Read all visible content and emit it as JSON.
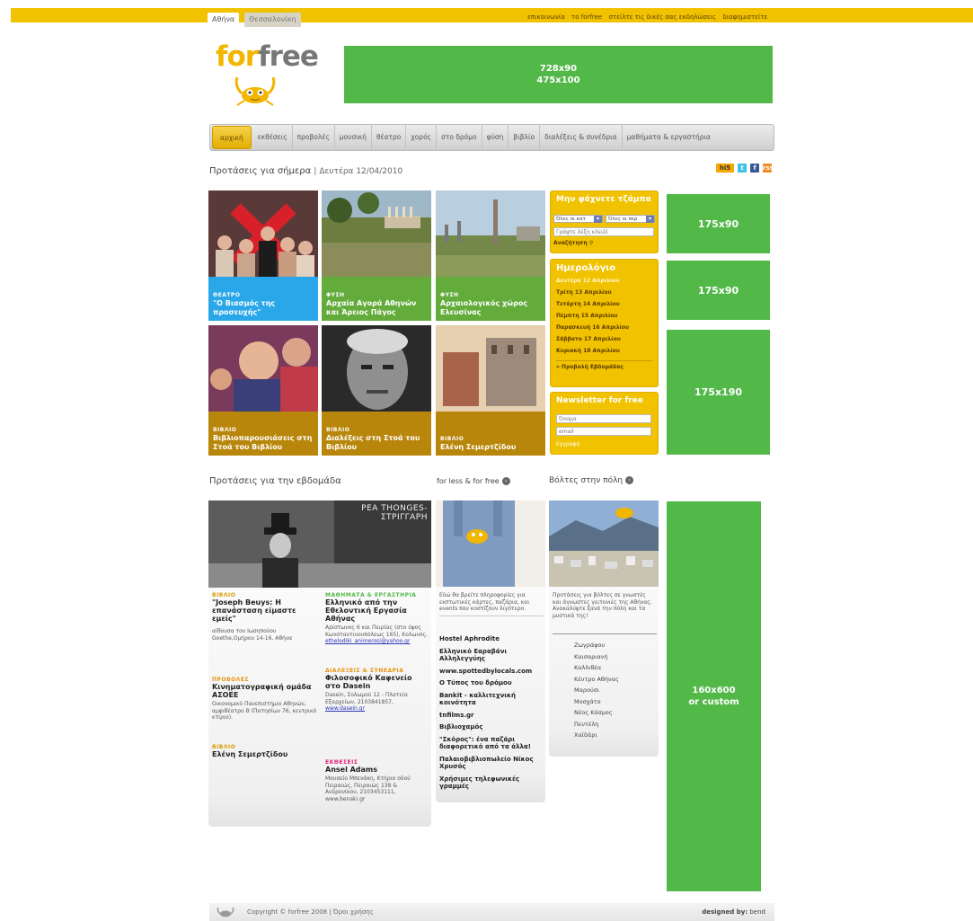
{
  "city_tabs": [
    "Αθήνα",
    "Θεσσαλονίκη"
  ],
  "top_links": [
    "επικοινωνία",
    "το forfree",
    "στείλτε τις δικές σας εκδηλώσεις",
    "διαφημιστείτε"
  ],
  "logo": {
    "part1": "for",
    "part2": "free"
  },
  "banner": {
    "line1": "728x90",
    "line2": "475x100"
  },
  "nav": [
    "αρχική",
    "εκθέσεις",
    "προβολές",
    "μουσική",
    "θέατρο",
    "χορός",
    "στο δρόμο",
    "φύση",
    "βιβλίο",
    "διαλέξεις & συνέδρια",
    "μαθήματα & εργαστήρια"
  ],
  "today": {
    "title": "Προτάσεις για σήμερα",
    "date": "| Δευτέρα 12/04/2010"
  },
  "social": [
    "hi5",
    "t",
    "f",
    "rss"
  ],
  "tiles": [
    {
      "category": "ΘΕΑΤΡΟ",
      "title": "\"Ο Βιασμός της προσευχής\""
    },
    {
      "category": "ΦΥΣΗ",
      "title": "Αρχαία Αγορά Αθηνών και Άρειος Πάγος"
    },
    {
      "category": "ΦΥΣΗ",
      "title": "Αρχαιολογικός χώρος Ελευσίνας"
    },
    {
      "category": "ΒΙΒΛΙΟ",
      "title": "Βιβλιοπαρουσιάσεις στη Στοά του Βιβλίου"
    },
    {
      "category": "ΒΙΒΛΙΟ",
      "title": "Διαλέξεις στη Στοά του Βιβλίου"
    },
    {
      "category": "ΒΙΒΛΙΟ",
      "title": "Ελένη Σεμερτζίδου"
    }
  ],
  "search_widget": {
    "title": "Μην φάχνετε τζάμπα",
    "select1": "Όλες οι κατ",
    "select2": "Όλες οι περ",
    "keyword_placeholder": "Γράψτε λέξη κλειδί",
    "search_label": "Αναζήτηση"
  },
  "calendar": {
    "title": "Ημερολόγιο",
    "days": [
      "Δευτέρα 12 Απριλίου",
      "Τρίτη 13 Απριλίου",
      "Τετάρτη 14 Απριλίου",
      "Πέμπτη 15 Απριλίου",
      "Παρασκευή 16 Απριλίου",
      "Σάββατο 17 Απριλίου",
      "Κυριακή 18 Απριλίου"
    ],
    "week_link": "» Προβολή Εβδομάδας"
  },
  "newsletter": {
    "title": "Newsletter for free",
    "name_placeholder": "Όνομα",
    "email_placeholder": "email",
    "signup_label": "Εγγραφή"
  },
  "ads": {
    "a1": "175x90",
    "a2": "175x90",
    "a3": "175x190",
    "sky1": "160x600",
    "sky2": "or custom"
  },
  "week": {
    "title": "Προτάσεις για την εβδομάδα",
    "banner_text": "ΡΕΑ ΤΗΟΝGES-ΣΤΡΙΓΓΑΡΗ",
    "left": [
      {
        "category": "ΒΙΒΛΙΟ",
        "title": "\"Joseph Beuys: Η επανάσταση είμαστε εμείς\"",
        "text": "αίθουσα του Ιωσηπούου Goethe,Ομήρου 14-16, Αθήνα"
      },
      {
        "category": "ΠΡΟΒΟΛΕΣ",
        "title": "Κινηματογραφική ομάδα ΑΣΟΕΕ",
        "text": "Οικονομικό Πανεπιστήμιο Αθηνών, αμφιθέατρο Β (Πατησίων 76, κεντρικό κτίριο)."
      },
      {
        "category": "ΒΙΒΛΙΟ",
        "title": "Ελένη Σεμερτζίδου",
        "text": ""
      }
    ],
    "right": [
      {
        "category": "ΜΑΘΗΜΑΤΑ & ΕΡΓΑΣΤΗΡΙΑ",
        "title": "Ελληνικό από την Εθελοντική Εργασία Αθήνας",
        "text": "Αρίστωνος 6 και Πειρίας (στο ύψος Κωνσταντινουπόλεως 165), Κολωνός,",
        "link": "ethelodiki_animerosi@yahoo.gr"
      },
      {
        "category": "ΔΙΑΛΕΞΕΙΣ & ΣΥΝΕΔΡΙΑ",
        "title": "Φιλοσοφικό Καφενείο στο Dasein",
        "text": "Dasein, Σολωμού 12 - Πλατεία Εξαρχείων, 2103841857,",
        "link": "www.dasein.gr"
      },
      {
        "category": "ΕΚΘΕΣΕΙΣ",
        "title": "Ansel Adams",
        "text": "Μουσείο Μπενάκη, Κτήριο οδού Πειραιώς, Πειραιώς 138 & Ανδρονίκου, 2103453111, www.benaki.gr",
        "link": ""
      }
    ]
  },
  "forless": {
    "title": "for less & for free",
    "intro": "Εδώ θα βρείτε πληροφορίες για εκπτωτικές κάρτες, παζάρια, και events που κοστίζουν λιγότερο.",
    "items": [
      "Hostel Aphrodite",
      "Ελληνικό Εαραβάνι Αλληλεγγύης",
      "www.spottedbylocals.com",
      "Ο Τύπος του δρόμου",
      "Bankit - καλλιτεχνική κοινότητα",
      "tnfilms.gr",
      "Βιβλιοχαμός",
      "\"Σκόρος\": ένα παζάρι διαφορετικό από τα άλλα!",
      "Παλαιοβιβλιοπωλείο Νίκος Χρυσός",
      "Χρήσιμες τηλεφωνικές γραμμές"
    ]
  },
  "volta": {
    "title": "Βόλτες στην πόλη",
    "intro": "Προτάσεις για βόλτες σε γνωστές και άγνωστες γειτονιές της Αθήνας. Ανακαλύψτε ξανά την πόλη και τα μυστικά της!",
    "items": [
      "Ζωγράφου",
      "Καισαριανή",
      "Καλλιθέα",
      "Κέντρο Αθήνας",
      "Μαρούσι",
      "Μοσχάτο",
      "Νέος Κόσμος",
      "Πεντέλη",
      "Χαϊδάρι"
    ]
  },
  "footer": {
    "copyright": "Copyright © forfree 2008 | Όροι χρήσης",
    "designed_label": "designed by:",
    "designer": "bend"
  }
}
